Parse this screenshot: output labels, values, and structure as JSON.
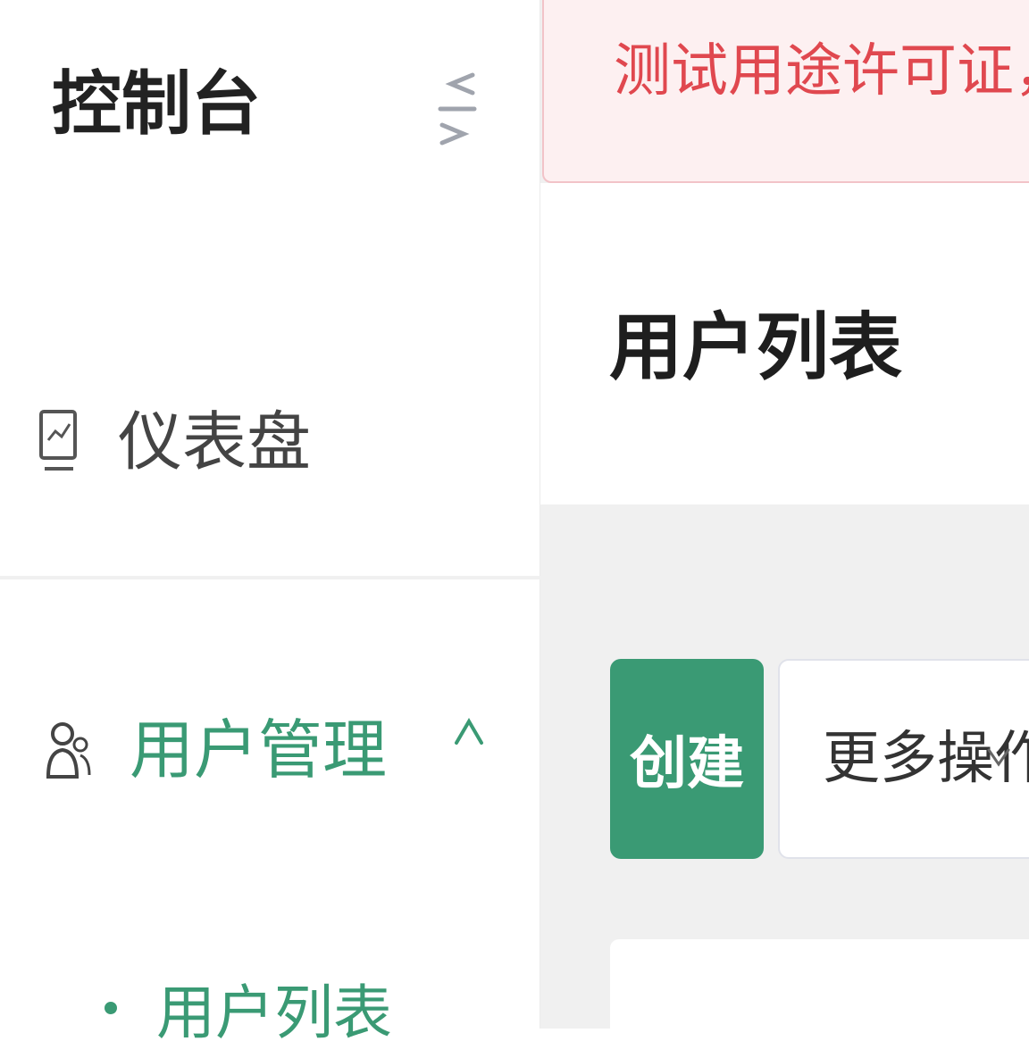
{
  "sidebar": {
    "title": "控制台",
    "items": [
      {
        "label": "仪表盘",
        "icon": "dashboard-icon"
      },
      {
        "label": "用户管理",
        "icon": "users-icon",
        "expanded": true,
        "children": [
          {
            "label": "用户列表",
            "active": true
          }
        ]
      }
    ]
  },
  "banner": {
    "text": "测试用途许可证，本许可证"
  },
  "page": {
    "title": "用户列表"
  },
  "toolbar": {
    "create_label": "创建",
    "more_label": "更多操作"
  },
  "colors": {
    "accent": "#3a9a74",
    "warning_text": "#e0484f",
    "warning_bg": "#fdf0f1"
  }
}
